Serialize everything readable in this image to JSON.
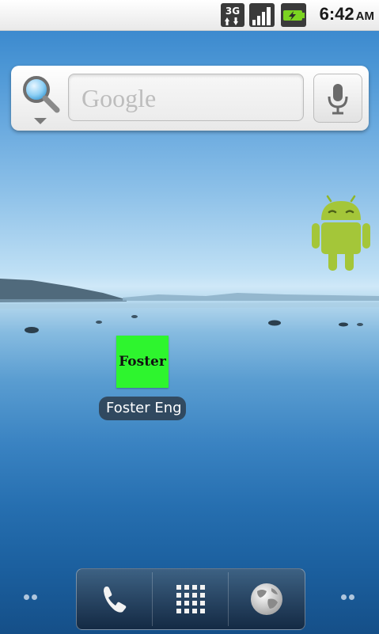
{
  "status_bar": {
    "network_type": "3G",
    "time": "6:42",
    "ampm": "AM",
    "icons": [
      "3g-data-icon",
      "signal-strength-icon",
      "battery-charging-icon"
    ]
  },
  "search_widget": {
    "placeholder": "Google",
    "source_icon": "search-icon",
    "voice_icon": "microphone-icon"
  },
  "widgets": {
    "android_icon": "android-robot-icon"
  },
  "shortcut": {
    "icon_text": "Foster",
    "label": "Foster Eng",
    "icon_color": "#2ef52e"
  },
  "dock": {
    "items": [
      {
        "name": "phone",
        "icon": "phone-icon"
      },
      {
        "name": "app-launcher",
        "icon": "grid-icon"
      },
      {
        "name": "browser",
        "icon": "globe-icon"
      }
    ]
  },
  "colors": {
    "status_bar_bg": "#f2f2f2",
    "search_widget_bg": "#f4f4f4",
    "android_green": "#a4c639"
  }
}
